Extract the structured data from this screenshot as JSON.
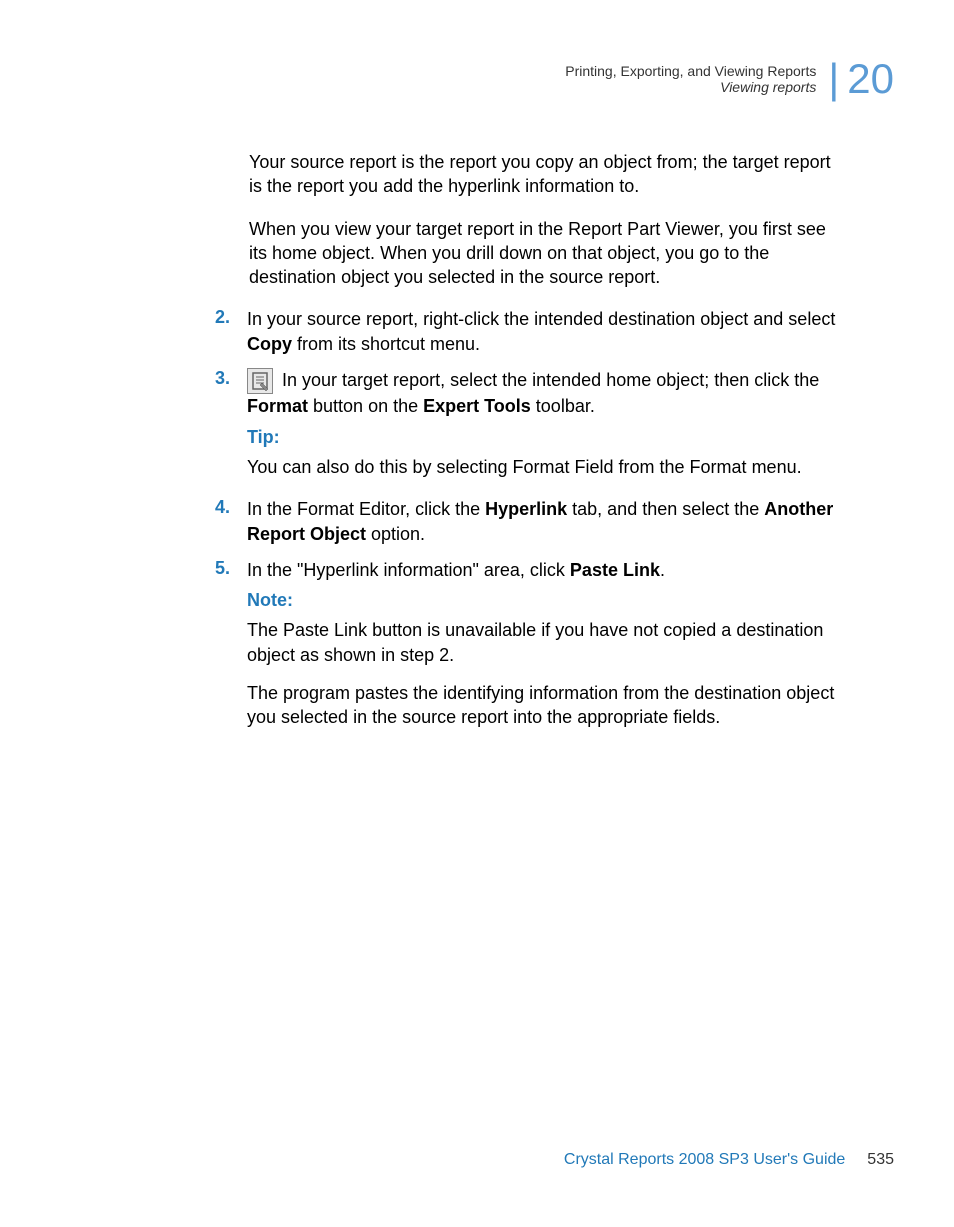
{
  "header": {
    "title": "Printing, Exporting, and Viewing Reports",
    "subtitle": "Viewing reports",
    "chapter": "20"
  },
  "intro": {
    "para1": "Your source report is the report you copy an object from; the target report is the report you add the hyperlink information to.",
    "para2": "When you view your target report in the Report Part Viewer, you first see its home object. When you drill down on that object, you go to the destination object you selected in the source report."
  },
  "steps": {
    "s2": {
      "num": "2.",
      "text1": "In your source report, right-click the intended destination object and select ",
      "bold1": "Copy",
      "text2": " from its shortcut menu."
    },
    "s3": {
      "num": "3.",
      "text1": " In your target report, select the intended home object; then click the ",
      "bold1": "Format",
      "text2": " button on the ",
      "bold2": "Expert Tools",
      "text3": " toolbar.",
      "tipLabel": "Tip:",
      "tipText": "You can also do this by selecting Format Field from the Format menu."
    },
    "s4": {
      "num": "4.",
      "text1": "In the Format Editor, click the ",
      "bold1": "Hyperlink",
      "text2": " tab, and then select the ",
      "bold2": "Another Report Object",
      "text3": " option."
    },
    "s5": {
      "num": "5.",
      "text1": "In the \"Hyperlink information\" area, click ",
      "bold1": "Paste Link",
      "text2": ".",
      "noteLabel": "Note:",
      "noteText": "The Paste Link button is unavailable if you have not copied a destination object as shown in step 2.",
      "para": "The program pastes the identifying information from the destination object you selected in the source report into the appropriate fields."
    }
  },
  "footer": {
    "title": "Crystal Reports 2008 SP3 User's Guide",
    "page": "535"
  }
}
